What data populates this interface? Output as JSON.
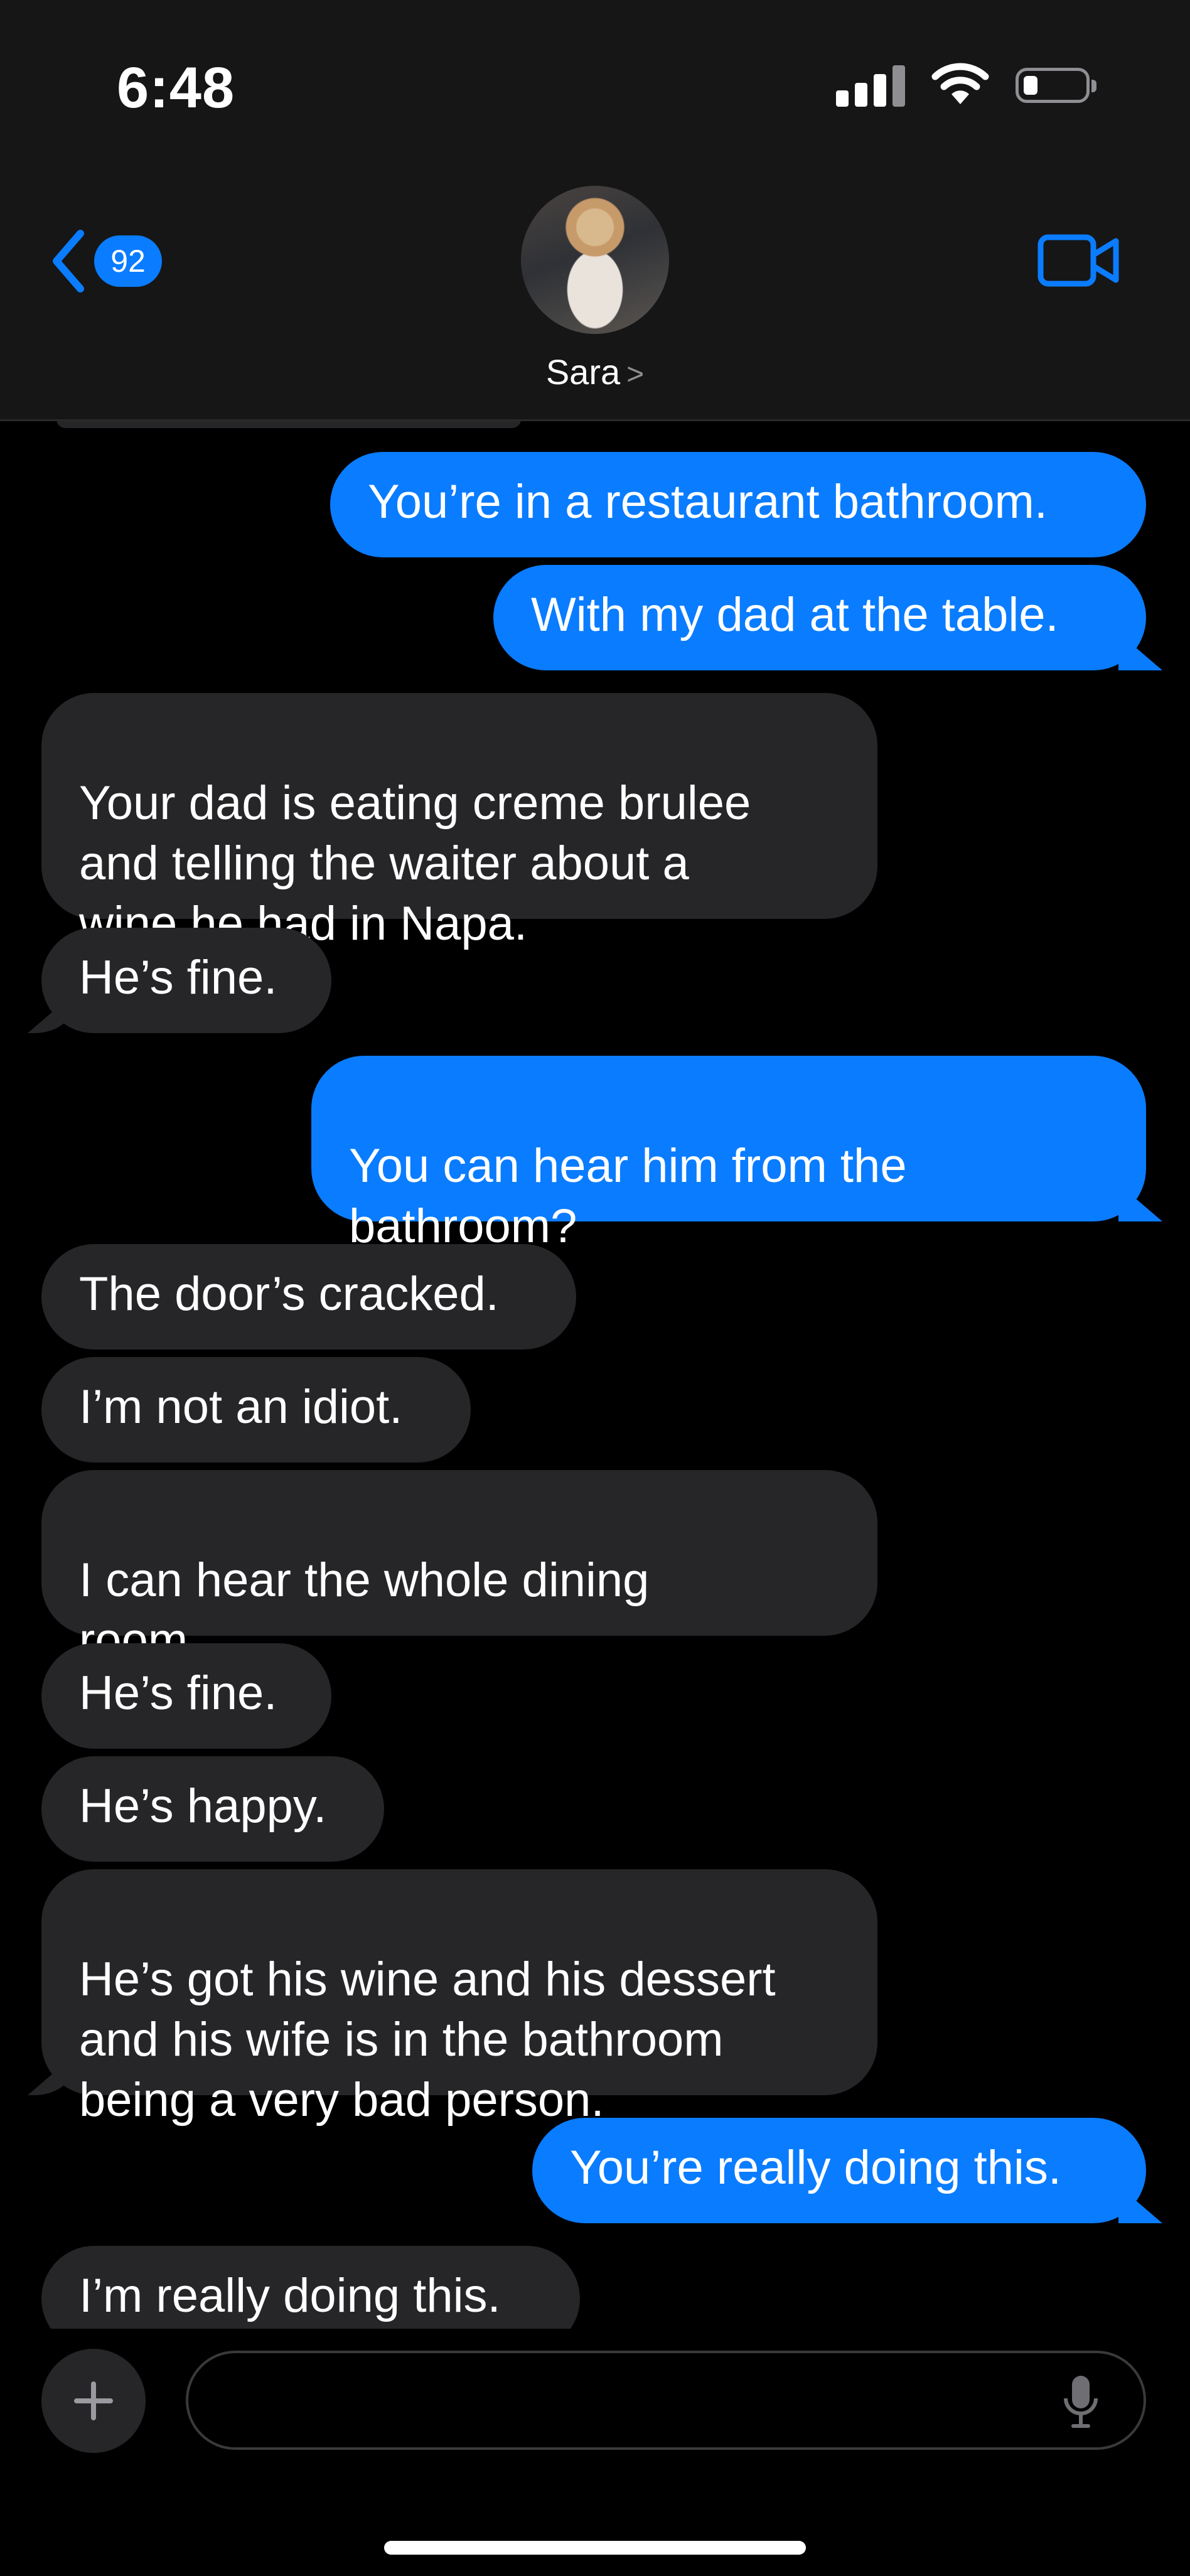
{
  "status_bar": {
    "time": "6:48"
  },
  "header": {
    "back_badge": "92",
    "contact_name": "Sara",
    "chevron": ">"
  },
  "messages": [
    {
      "text": "You’re in a restaurant bathroom.",
      "dir": "out"
    },
    {
      "text": "With my dad at the table.",
      "dir": "out"
    },
    {
      "text": "Your dad is eating creme brulee\nand telling the waiter about a\nwine he had in Napa.",
      "dir": "in"
    },
    {
      "text": "He’s fine.",
      "dir": "in"
    },
    {
      "text": "You can hear him from the\nbathroom?",
      "dir": "out"
    },
    {
      "text": "The door’s cracked.",
      "dir": "in"
    },
    {
      "text": "I’m not an idiot.",
      "dir": "in"
    },
    {
      "text": "I can hear the whole dining\nroom.",
      "dir": "in"
    },
    {
      "text": "He’s fine.",
      "dir": "in"
    },
    {
      "text": "He’s happy.",
      "dir": "in"
    },
    {
      "text": "He’s got his wine and his dessert\nand his wife is in the bathroom\nbeing a very bad person.",
      "dir": "in"
    },
    {
      "text": "You’re really doing this.",
      "dir": "out"
    },
    {
      "text": "I’m really doing this.",
      "dir": "in"
    }
  ],
  "composer": {
    "placeholder": ""
  },
  "colors": {
    "accent": "#0a7cff",
    "incoming_bubble": "#262628",
    "background": "#000000"
  },
  "icons": [
    "back-chevron-icon",
    "video-camera-icon",
    "plus-icon",
    "microphone-icon",
    "wifi-icon",
    "battery-icon",
    "signal-icon"
  ]
}
